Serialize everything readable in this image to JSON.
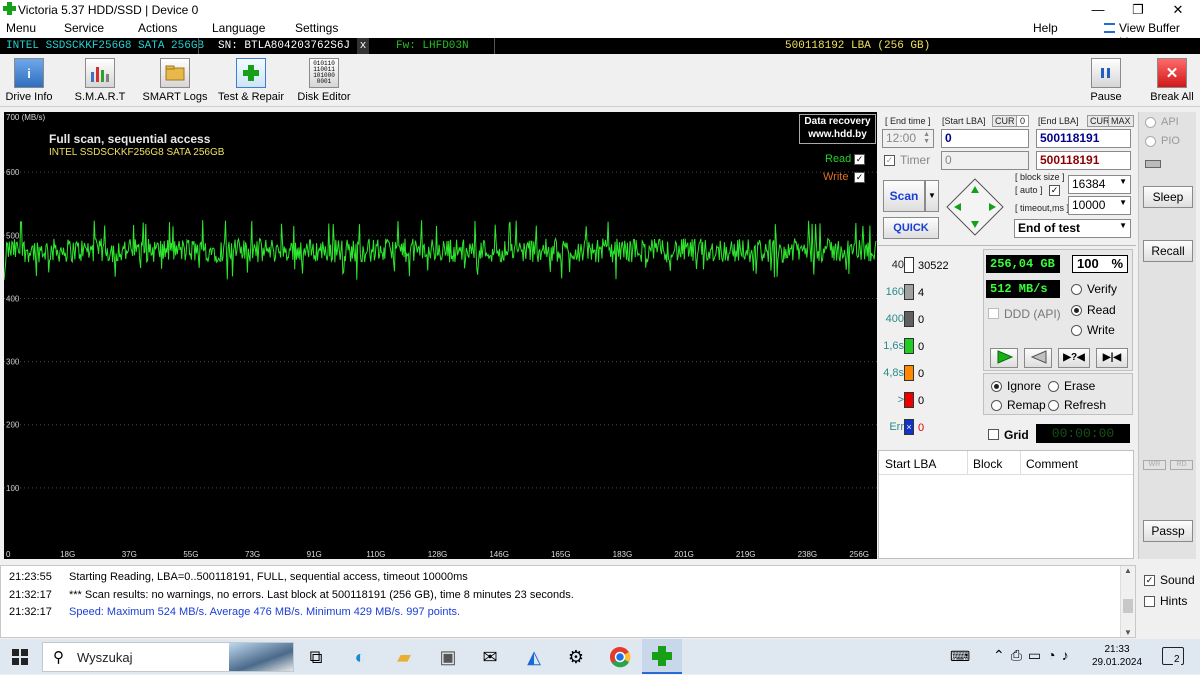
{
  "window": {
    "title": "Victoria 5.37 HDD/SSD | Device 0",
    "minimize": "—",
    "maximize": "❐",
    "close": "✕"
  },
  "menu": {
    "items": [
      "Menu",
      "Service",
      "Actions",
      "Language",
      "Settings"
    ],
    "help": "Help",
    "view_buffer": "View Buffer Live"
  },
  "drive_bar": {
    "model": "INTEL SSDSCKKF256G8 SATA 256GB",
    "serial": "SN: BTLA804203762S6J",
    "close_x": "x",
    "firmware": "Fw: LHFD03N",
    "capacity": "500118192 LBA (256 GB)"
  },
  "toolbar": {
    "drive_info": "Drive Info",
    "smart": "S.M.A.R.T",
    "smart_logs": "SMART Logs",
    "test_repair": "Test & Repair",
    "disk_editor": "Disk Editor",
    "pause": "Pause",
    "break_all": "Break All"
  },
  "graph": {
    "unit_label": "700 (MB/s)",
    "title": "Full scan, sequential access",
    "subtitle": "INTEL SSDSCKKF256G8 SATA 256GB",
    "data_recovery_1": "Data recovery",
    "data_recovery_2": "www.hdd.by",
    "read_label": "Read",
    "write_label": "Write",
    "read_checked": true,
    "write_checked": true,
    "line_color": "#2ee62e",
    "y_ticks": [
      "600",
      "500",
      "400",
      "300",
      "200",
      "100"
    ],
    "x_ticks": [
      "0",
      "18G",
      "37G",
      "55G",
      "73G",
      "91G",
      "110G",
      "128G",
      "146G",
      "165G",
      "183G",
      "201G",
      "219G",
      "238G",
      "256G"
    ]
  },
  "chart_data": {
    "type": "line",
    "title": "Full scan, sequential access",
    "ylabel": "700 (MB/s)",
    "xlabel": "",
    "ylim": [
      0,
      700
    ],
    "xlim": [
      0,
      256
    ],
    "x_tick_labels": [
      "0",
      "18G",
      "37G",
      "55G",
      "73G",
      "91G",
      "110G",
      "128G",
      "146G",
      "165G",
      "183G",
      "201G",
      "219G",
      "238G",
      "256G"
    ],
    "y_tick_labels": [
      "100",
      "200",
      "300",
      "400",
      "500",
      "600"
    ],
    "series": [
      {
        "name": "Read",
        "color": "#2ee62e",
        "mean": 476,
        "min": 429,
        "max": 524,
        "points": 997
      }
    ],
    "grid": true
  },
  "controls": {
    "end_time_label": "[ End time ]",
    "end_time_value": "12:00",
    "start_lba_label": "[Start LBA]",
    "cur_label": "CUR",
    "cur_value": "0",
    "start_lba_value": "0",
    "end_lba_label": "[End LBA]",
    "max_label": "MAX",
    "end_lba_value": "500118191",
    "timer_label": "Timer",
    "timer_value": "0",
    "end_lba_value2": "500118191",
    "scan_label": "Scan",
    "quick_label": "QUICK",
    "block_size_label": "[ block size ]",
    "auto_label": "[ auto ]",
    "block_size_value": "16384",
    "timeout_label": "[ timeout,ms ]",
    "timeout_value": "10000",
    "end_action": "End of test"
  },
  "stats": [
    {
      "label": "40",
      "count": "30522",
      "color": "#ffffff",
      "label_color": "#222222"
    },
    {
      "label": "160",
      "count": "4",
      "color": "#a0a0a0",
      "label_color": "#2a8a8a"
    },
    {
      "label": "400",
      "count": "0",
      "color": "#606060",
      "label_color": "#2a8a8a"
    },
    {
      "label": "1,6s",
      "count": "0",
      "color": "#22cc22",
      "label_color": "#2a8a8a"
    },
    {
      "label": "4,8s",
      "count": "0",
      "color": "#ff8800",
      "label_color": "#2a8a8a"
    },
    {
      "label": ">",
      "count": "0",
      "color": "#ee0000",
      "label_color": "#2a8a8a"
    },
    {
      "label": "Err",
      "count": "0",
      "color": "#1133cc",
      "label_color": "#2a8a8a"
    }
  ],
  "status": {
    "gb_read": "256,04 GB",
    "percent": "100",
    "percent_sign": "%",
    "speed": "512 MB/s",
    "ddd_label": "DDD (API)",
    "verify_label": "Verify",
    "read_label": "Read",
    "write_label": "Write",
    "ignore_label": "Ignore",
    "erase_label": "Erase",
    "remap_label": "Remap",
    "refresh_label": "Refresh",
    "grid_label": "Grid",
    "grid_timer": "00:00:00"
  },
  "table": {
    "headers": [
      "Start LBA",
      "Block",
      "Comment"
    ]
  },
  "right_panel": {
    "api": "API",
    "pio": "PIO",
    "sleep": "Sleep",
    "recall": "Recall",
    "wr": "WR",
    "rd": "RD",
    "passp": "Passp"
  },
  "log": [
    {
      "time": "21:23:55",
      "text": "Starting Reading, LBA=0..500118191, FULL, sequential access, timeout 10000ms",
      "color": "#000000"
    },
    {
      "time": "21:32:17",
      "text": "*** Scan results: no warnings, no errors. Last block at 500118191 (256 GB), time 8 minutes 23 seconds.",
      "color": "#000000"
    },
    {
      "time": "21:32:17",
      "text": "Speed: Maximum 524 MB/s. Average 476 MB/s. Minimum 429 MB/s. 997 points.",
      "color": "#1a3fd6"
    }
  ],
  "log_options": {
    "sound": "Sound",
    "hints": "Hints",
    "sound_checked": true,
    "hints_checked": false
  },
  "taskbar": {
    "search_placeholder": "Wyszukaj",
    "time": "21:33",
    "date": "29.01.2024",
    "notifications": "2"
  }
}
